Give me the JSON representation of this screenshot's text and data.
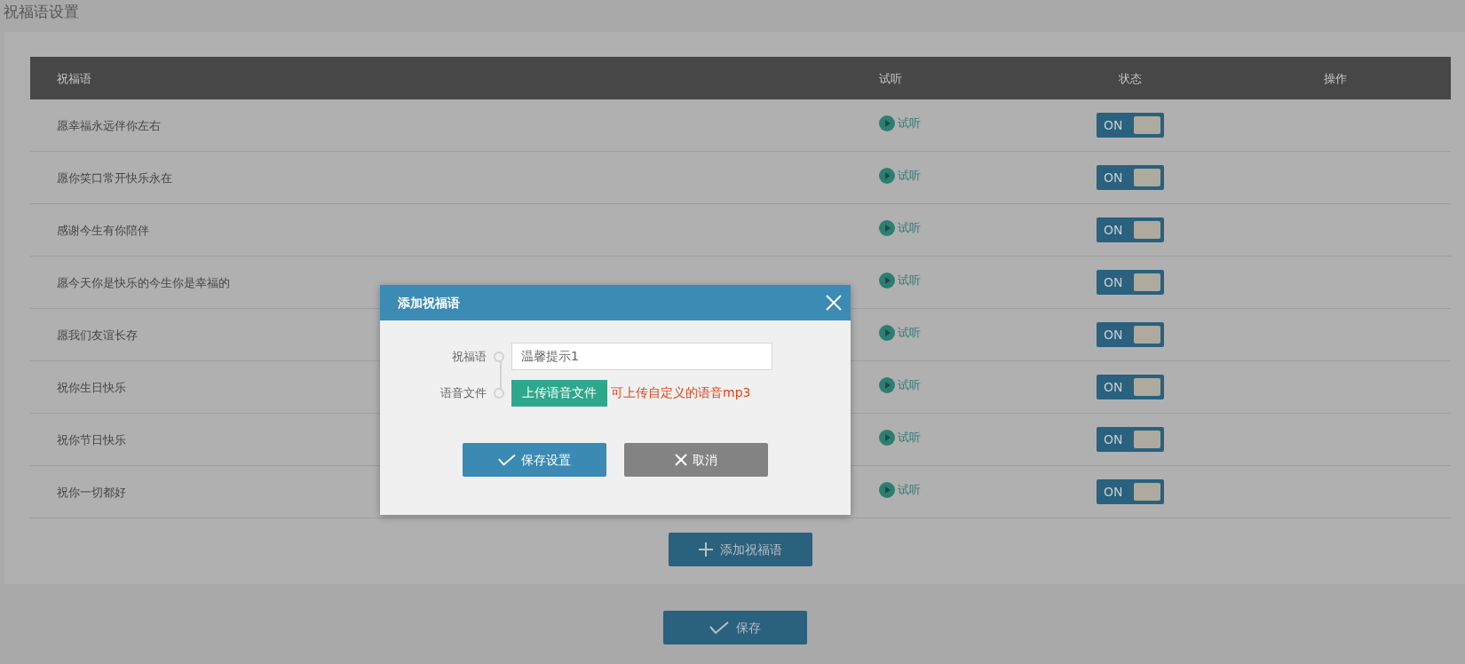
{
  "page_title": "祝福语设置",
  "table": {
    "columns": [
      "祝福语",
      "试听",
      "状态",
      "操作"
    ],
    "rows": [
      {
        "text": "愿幸福永远伴你左右",
        "listen": "试听",
        "status": {
          "label": "ON",
          "on": true
        }
      },
      {
        "text": "愿你笑口常开快乐永在",
        "listen": "试听",
        "status": {
          "label": "ON",
          "on": true
        }
      },
      {
        "text": "感谢今生有你陪伴",
        "listen": "试听",
        "status": {
          "label": "ON",
          "on": true
        }
      },
      {
        "text": "愿今天你是快乐的今生你是幸福的",
        "listen": "试听",
        "status": {
          "label": "ON",
          "on": true
        }
      },
      {
        "text": "愿我们友谊长存",
        "listen": "试听",
        "status": {
          "label": "ON",
          "on": true
        }
      },
      {
        "text": "祝你生日快乐",
        "listen": "试听",
        "status": {
          "label": "ON",
          "on": true
        }
      },
      {
        "text": "祝你节日快乐",
        "listen": "试听",
        "status": {
          "label": "ON",
          "on": true
        }
      },
      {
        "text": "祝你一切都好",
        "listen": "试听",
        "status": {
          "label": "ON",
          "on": true
        }
      }
    ]
  },
  "add_button": "添加祝福语",
  "save_button": "保存",
  "dialog": {
    "title": "添加祝福语",
    "fields": [
      {
        "kind": "text",
        "label": "祝福语",
        "value": "温馨提示1"
      },
      {
        "kind": "upload",
        "label": "语音文件",
        "button": "上传语音文件",
        "hint": "可上传自定义的语音mp3"
      }
    ],
    "save_button": "保存设置",
    "cancel_button": "取消"
  }
}
